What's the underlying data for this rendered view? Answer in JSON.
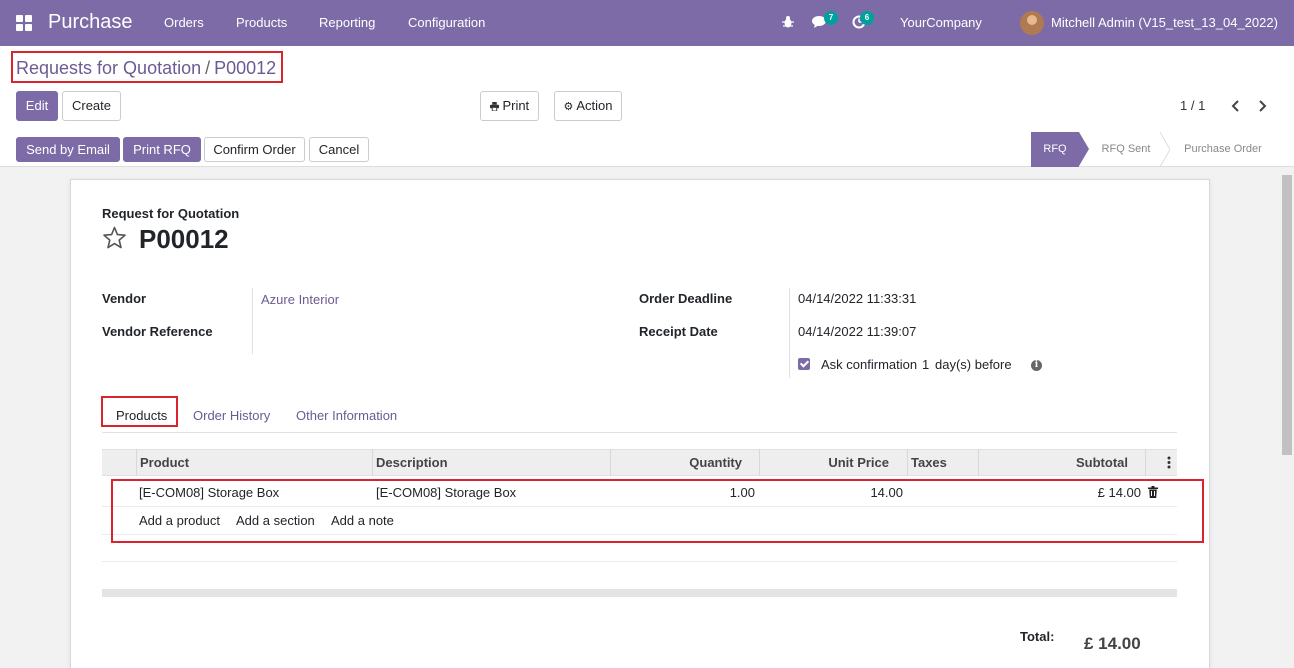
{
  "navbar": {
    "app_name": "Purchase",
    "menu": [
      "Orders",
      "Products",
      "Reporting",
      "Configuration"
    ],
    "messages_count": "7",
    "activities_count": "6",
    "company": "YourCompany",
    "user": "Mitchell Admin (V15_test_13_04_2022)"
  },
  "breadcrumb": {
    "parent": "Requests for Quotation",
    "separator": "/",
    "current": "P00012"
  },
  "control": {
    "edit": "Edit",
    "create": "Create",
    "print": "Print",
    "action": "Action",
    "pager": "1 / 1"
  },
  "statusbar": {
    "buttons": [
      "Send by Email",
      "Print RFQ",
      "Confirm Order",
      "Cancel"
    ],
    "stages": [
      "RFQ",
      "RFQ Sent",
      "Purchase Order"
    ],
    "active_stage": "RFQ"
  },
  "form": {
    "doc_type": "Request for Quotation",
    "name": "P00012",
    "vendor_label": "Vendor",
    "vendor_value": "Azure Interior",
    "vendor_ref_label": "Vendor Reference",
    "vendor_ref_value": "",
    "deadline_label": "Order Deadline",
    "deadline_value": "04/14/2022 11:33:31",
    "receipt_label": "Receipt Date",
    "receipt_value": "04/14/2022 11:39:07",
    "ask_confirm_text": "Ask confirmation",
    "ask_confirm_days": "1",
    "ask_confirm_suffix": "day(s) before",
    "ask_confirm_checked": true
  },
  "tabs": [
    "Products",
    "Order History",
    "Other Information"
  ],
  "table": {
    "headers": [
      "Product",
      "Description",
      "Quantity",
      "Unit Price",
      "Taxes",
      "Subtotal"
    ],
    "rows": [
      {
        "product": "[E-COM08] Storage Box",
        "description": "[E-COM08] Storage Box",
        "quantity": "1.00",
        "unit_price": "14.00",
        "taxes": "",
        "subtotal": "£ 14.00"
      }
    ],
    "add_product": "Add a product",
    "add_section": "Add a section",
    "add_note": "Add a note"
  },
  "totals": {
    "label": "Total:",
    "value": "£ 14.00"
  },
  "colors": {
    "brand": "#7c6ba6",
    "badge": "#00a09d",
    "highlight": "#d9232d"
  }
}
